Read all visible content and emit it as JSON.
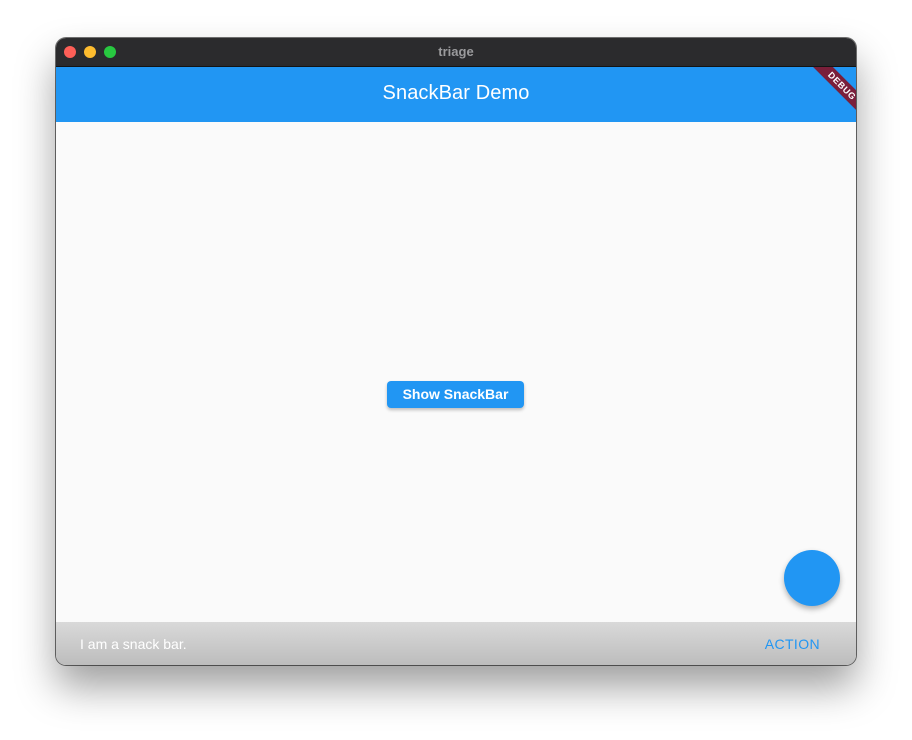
{
  "window": {
    "title": "triage"
  },
  "appbar": {
    "title": "SnackBar Demo",
    "debug_banner": "DEBUG"
  },
  "main": {
    "show_button_label": "Show SnackBar"
  },
  "fab": {
    "icon": "none"
  },
  "snackbar": {
    "message": "I am a snack bar.",
    "action_label": "ACTION"
  },
  "colors": {
    "primary": "#2196f3",
    "debug_banner": "#7a1f3a",
    "titlebar": "#2b2b2d",
    "background": "#fafafa"
  }
}
